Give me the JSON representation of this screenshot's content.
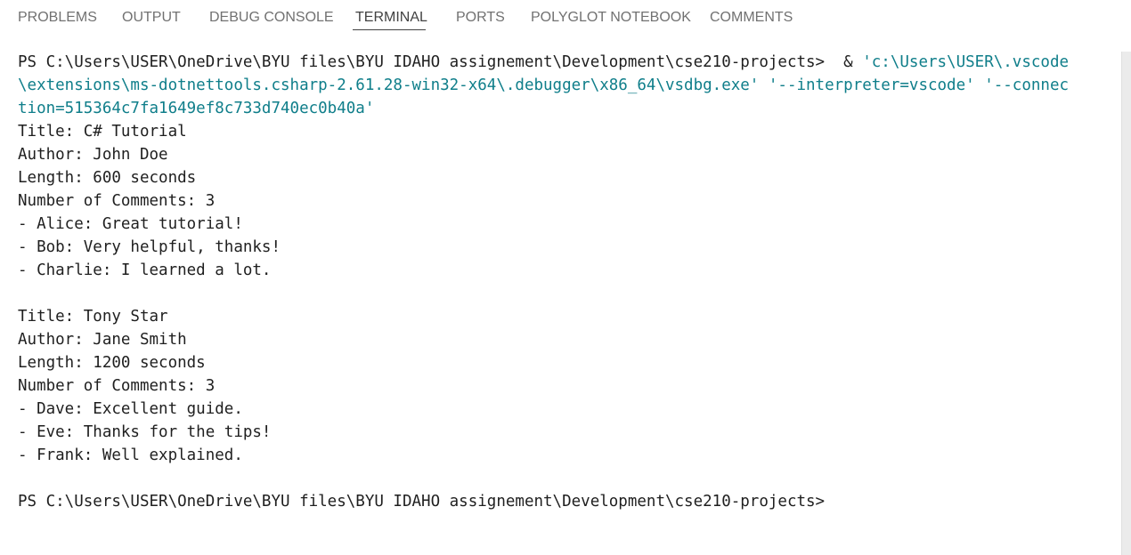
{
  "tabs": [
    {
      "label": "PROBLEMS",
      "active": false
    },
    {
      "label": "OUTPUT",
      "active": false
    },
    {
      "label": "DEBUG CONSOLE",
      "active": false
    },
    {
      "label": "TERMINAL",
      "active": true
    },
    {
      "label": "PORTS",
      "active": false
    },
    {
      "label": "POLYGLOT NOTEBOOK",
      "active": false
    },
    {
      "label": "COMMENTS",
      "active": false
    }
  ],
  "terminal": {
    "prompt_line": "PS C:\\Users\\USER\\OneDrive\\BYU files\\BYU IDAHO assignement\\Development\\cse210-projects>  & ",
    "command_part1": "'c:\\Users\\USER\\.vscode",
    "command_part2": "\\extensions\\ms-dotnettools.csharp-2.61.28-win32-x64\\.debugger\\x86_64\\vsdbg.exe' '--interpreter=vscode' '--connec",
    "command_part3": "tion=515364c7fa1649ef8c733d740ec0b40a'",
    "output": [
      "Title: C# Tutorial",
      "Author: John Doe",
      "Length: 600 seconds",
      "Number of Comments: 3",
      "- Alice: Great tutorial!",
      "- Bob: Very helpful, thanks!",
      "- Charlie: I learned a lot.",
      "",
      "Title: Tony Star",
      "Author: Jane Smith",
      "Length: 1200 seconds",
      "Number of Comments: 3",
      "- Dave: Excellent guide.",
      "- Eve: Thanks for the tips!",
      "- Frank: Well explained.",
      ""
    ],
    "final_prompt": "PS C:\\Users\\USER\\OneDrive\\BYU files\\BYU IDAHO assignement\\Development\\cse210-projects>"
  },
  "colors": {
    "command_accent": "#0f7e8a",
    "text": "#1f1f1f",
    "tab_inactive": "#717171",
    "tab_active": "#424242"
  }
}
